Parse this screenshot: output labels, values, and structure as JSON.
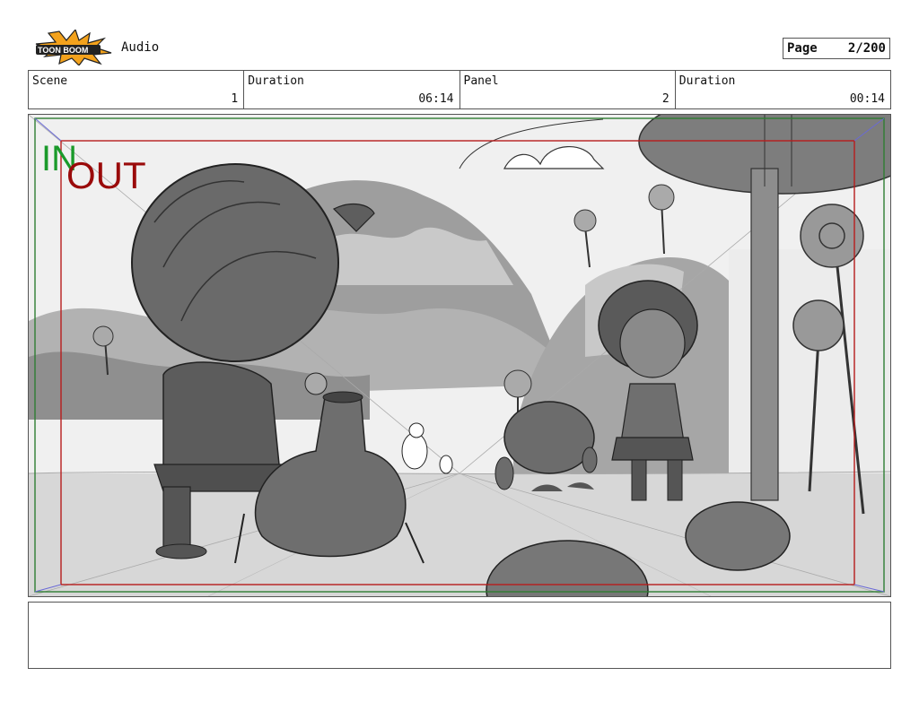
{
  "header": {
    "logo_alt": "TOON BOOM",
    "audio_label": "Audio",
    "page_label": "Page",
    "page_value": "2/200"
  },
  "info": {
    "scene_label": "Scene",
    "scene_value": "1",
    "duration_label": "Duration",
    "duration_value": "06:14",
    "panel_label": "Panel",
    "panel_value": "2",
    "panel_duration_label": "Duration",
    "panel_duration_value": "00:14"
  },
  "panel": {
    "in_label": "IN",
    "out_label": "OUT",
    "in_color": "#1a9a2a",
    "out_color": "#9a0a0a"
  },
  "notes": {}
}
